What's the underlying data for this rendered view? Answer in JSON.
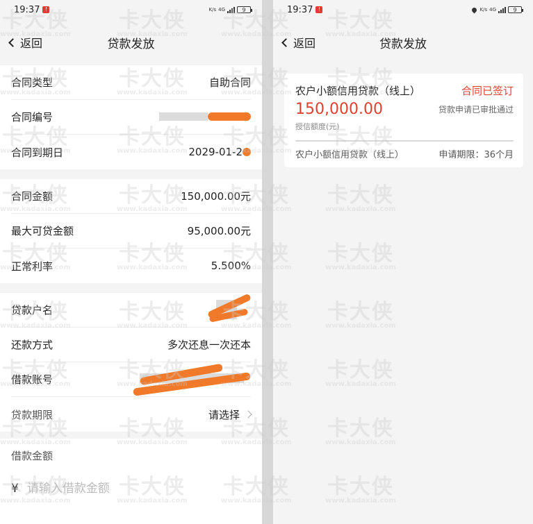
{
  "left": {
    "status": {
      "time": "19:37",
      "net_speed": "K/s",
      "network": "4G",
      "battery": "9"
    },
    "nav": {
      "back": "返回",
      "title": "贷款发放"
    },
    "group1": [
      {
        "label": "合同类型",
        "value": "自助合同"
      },
      {
        "label": "合同编号",
        "value": ""
      },
      {
        "label": "合同到期日",
        "value": "2029-01-2"
      }
    ],
    "group2": [
      {
        "label": "合同金额",
        "value": "150,000.00元"
      },
      {
        "label": "最大可贷金额",
        "value": "95,000.00元"
      },
      {
        "label": "正常利率",
        "value": "5.500%"
      }
    ],
    "group3": [
      {
        "label": "贷款户名",
        "value": ""
      },
      {
        "label": "还款方式",
        "value": "多次还息一次还本"
      },
      {
        "label": "借款账号",
        "value": ""
      },
      {
        "label": "贷款期限",
        "value": "请选择"
      }
    ],
    "amount": {
      "label": "借款金额",
      "currency": "¥",
      "placeholder": "请输入借款金额"
    }
  },
  "right": {
    "status": {
      "time": "19:37",
      "net_speed": "K/s",
      "network": "4G",
      "battery": "9"
    },
    "nav": {
      "back": "返回",
      "title": "贷款发放"
    },
    "card": {
      "product": "农户小额信用贷款（线上）",
      "status": "合同已签订",
      "amount": "150,000.00",
      "approval": "贷款申请已审批通过",
      "amount_label": "授信额度(元)",
      "footer_product": "农户小额信用贷款（线上）",
      "term": "申请期限：36个月"
    }
  },
  "watermark": {
    "brand": "卡大侠",
    "site": "www.kadaxia.com"
  },
  "colors": {
    "accent_red": "#e0402f",
    "redaction_orange": "#f07a2a"
  }
}
